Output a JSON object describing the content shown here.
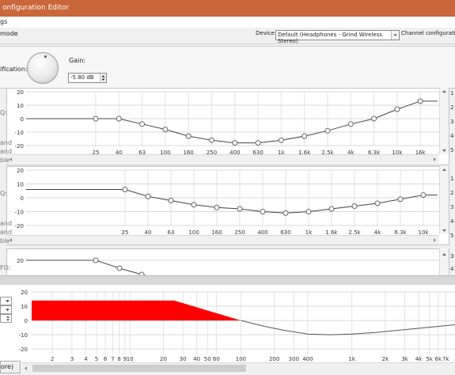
{
  "window": {
    "title": "onfiguration Editor"
  },
  "menu": {
    "settings": "gs"
  },
  "toolbar": {
    "mode": "mode",
    "device_label": "Device:",
    "device_value": "Default (Headphones - Grind Wireless Stereo)",
    "channel_label": "Channel configuration"
  },
  "amplification": {
    "label": "ification:",
    "gain_label": "Gain:",
    "gain_value": "-5.80 dB"
  },
  "eq_side": {
    "label": "Q:",
    "band": "and",
    "table": "ble"
  },
  "eq1": {
    "yticks": [
      "20",
      "10",
      "0",
      "-10",
      "-20"
    ],
    "xticks": [
      "25",
      "40",
      "63",
      "100",
      "160",
      "250",
      "400",
      "630",
      "1k",
      "1.6k",
      "2.5k",
      "4k",
      "6.3k",
      "10k",
      "16k"
    ],
    "values": [
      0,
      0,
      -4,
      -8,
      -13,
      -16,
      -18,
      -18,
      -16,
      -13,
      -9,
      -4,
      0,
      7,
      13
    ]
  },
  "eq2": {
    "yticks": [
      "20",
      "10",
      "0",
      "-10",
      "-20"
    ],
    "xticks": [
      "25",
      "40",
      "63",
      "100",
      "160",
      "250",
      "400",
      "630",
      "1k",
      "1.6k",
      "2.5k",
      "4k",
      "6.3k",
      "10k"
    ],
    "values": [
      6,
      1,
      -2,
      -5,
      -7,
      -8,
      -10,
      -11,
      -10,
      -8,
      -6,
      -4,
      -1,
      2
    ]
  },
  "scroll_numbers_1": [
    "1",
    "2",
    "3",
    "4",
    "5"
  ],
  "scroll_numbers_3": [
    "3",
    "4"
  ],
  "panel3": {
    "label": "FO:",
    "ytick": "20"
  },
  "response": {
    "yticks": [
      "20",
      "10",
      "0",
      "-10",
      "-20"
    ],
    "xticks": [
      "2",
      "3",
      "4",
      "5",
      "6",
      "7",
      "8",
      "9",
      "10",
      "20",
      "30",
      "40",
      "50",
      "60",
      "100",
      "200",
      "300",
      "400",
      "1k",
      "2k",
      "3k",
      "4k",
      "5k",
      "6k",
      "7k"
    ],
    "fill_color": "#ff0000"
  },
  "bottom_left": {
    "label": "ore)"
  }
}
